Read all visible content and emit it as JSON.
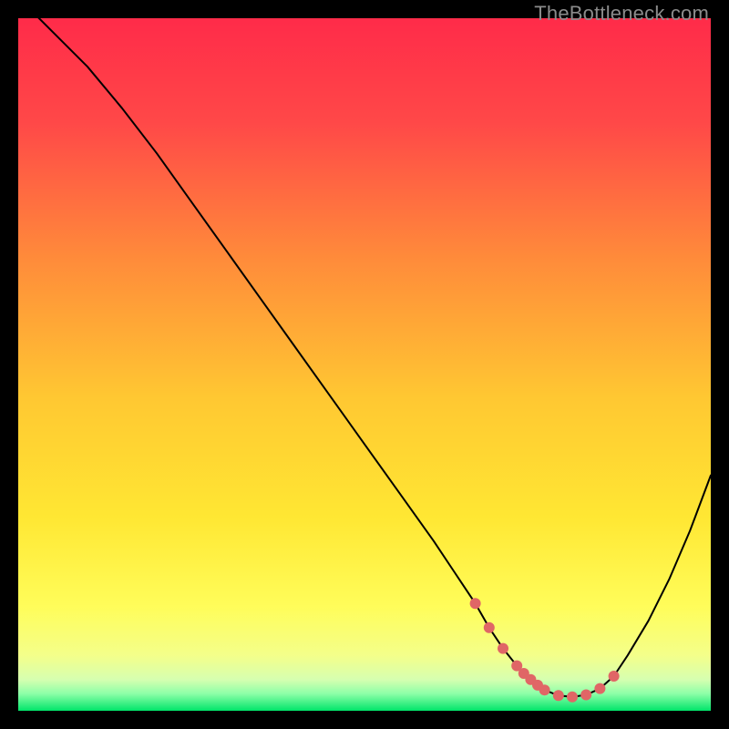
{
  "watermark": "TheBottleneck.com",
  "chart_data": {
    "type": "line",
    "title": "",
    "xlabel": "",
    "ylabel": "",
    "xlim": [
      0,
      100
    ],
    "ylim": [
      0,
      100
    ],
    "curve": {
      "x": [
        0,
        3,
        6,
        10,
        15,
        20,
        25,
        30,
        35,
        40,
        45,
        50,
        55,
        60,
        63,
        66,
        68,
        70,
        72,
        74,
        76,
        78,
        80,
        82,
        84,
        86,
        88,
        91,
        94,
        97,
        100
      ],
      "y": [
        103,
        100,
        97,
        93,
        87,
        80.5,
        73.5,
        66.5,
        59.5,
        52.5,
        45.5,
        38.5,
        31.5,
        24.5,
        20,
        15.5,
        12,
        9,
        6.5,
        4.5,
        3,
        2.2,
        2,
        2.3,
        3.2,
        5,
        8,
        13,
        19,
        26,
        34
      ],
      "stroke": "#000000",
      "stroke_width": 2
    },
    "optimal_dots": {
      "x": [
        66,
        68,
        70,
        72,
        73,
        74,
        75,
        76,
        78,
        80,
        82,
        84,
        86
      ],
      "y": [
        15.5,
        12,
        9,
        6.5,
        5.4,
        4.5,
        3.7,
        3,
        2.2,
        2,
        2.3,
        3.2,
        5
      ],
      "r": 6,
      "fill": "#e06666"
    },
    "colors": {
      "gradient_top": "#ff2b49",
      "gradient_bottom": "#00e56a",
      "curve": "#000000",
      "dots": "#e06666",
      "frame": "#000000"
    }
  }
}
